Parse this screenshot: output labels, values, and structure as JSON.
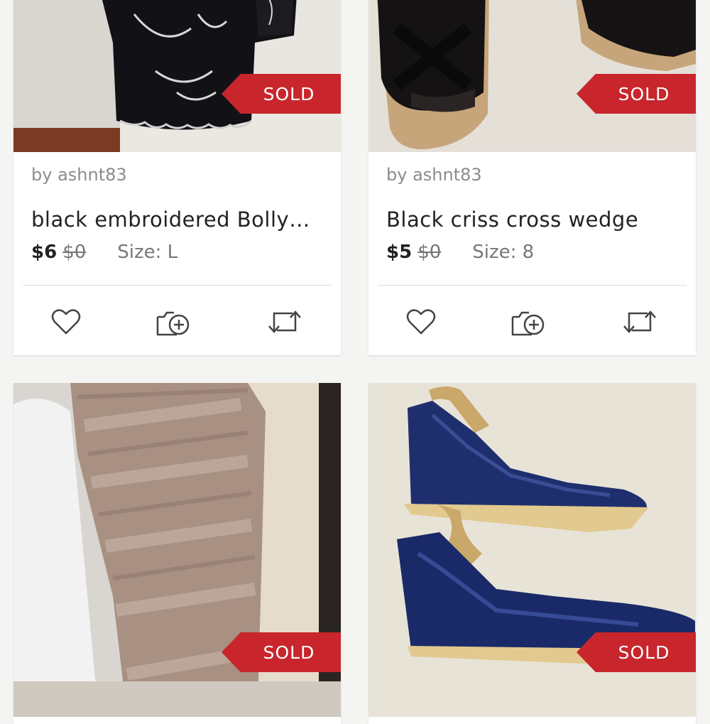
{
  "listings": [
    {
      "seller": "by ashnt83",
      "title": "black embroidered Bollywo...",
      "price": "$6",
      "original_price": "$0",
      "size": "Size: L",
      "badge": "SOLD"
    },
    {
      "seller": "by ashnt83",
      "title": "Black criss cross wedge",
      "price": "$5",
      "original_price": "$0",
      "size": "Size: 8",
      "badge": "SOLD"
    },
    {
      "badge": "SOLD"
    },
    {
      "badge": "SOLD"
    }
  ],
  "icons": {
    "like": "heart-icon",
    "add_to_bundle": "add-bundle-icon",
    "share": "share-icon"
  },
  "colors": {
    "sold_badge": "#c8262c",
    "background": "#f4f4f3",
    "card": "#ffffff"
  }
}
